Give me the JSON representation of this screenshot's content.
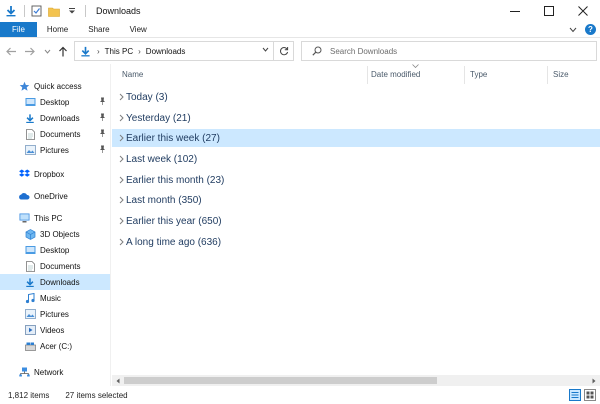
{
  "window": {
    "title": "Downloads",
    "controls": {
      "minimize": "—",
      "maximize": "☐",
      "close": "✕"
    }
  },
  "ribbon": {
    "tabs": [
      "File",
      "Home",
      "Share",
      "View"
    ],
    "help": "?"
  },
  "address": {
    "crumbs": [
      "This PC",
      "Downloads"
    ]
  },
  "search": {
    "placeholder": "Search Downloads"
  },
  "sidebar": {
    "items": [
      {
        "label": "Quick access",
        "icon": "star-icon",
        "pinned": false
      },
      {
        "label": "Desktop",
        "icon": "desktop-folder-icon",
        "pinned": true
      },
      {
        "label": "Downloads",
        "icon": "download-arrow-icon",
        "pinned": true
      },
      {
        "label": "Documents",
        "icon": "documents-icon",
        "pinned": true
      },
      {
        "label": "Pictures",
        "icon": "pictures-icon",
        "pinned": true
      },
      {
        "label": "Dropbox",
        "icon": "dropbox-icon",
        "pinned": false
      },
      {
        "label": "OneDrive",
        "icon": "cloud-icon",
        "pinned": false
      },
      {
        "label": "This PC",
        "icon": "computer-icon",
        "pinned": false
      },
      {
        "label": "3D Objects",
        "icon": "3d-objects-icon",
        "pinned": false
      },
      {
        "label": "Desktop",
        "icon": "desktop-folder-icon",
        "pinned": false
      },
      {
        "label": "Documents",
        "icon": "documents-icon",
        "pinned": false
      },
      {
        "label": "Downloads",
        "icon": "download-arrow-icon",
        "pinned": false,
        "selected": true
      },
      {
        "label": "Music",
        "icon": "music-icon",
        "pinned": false
      },
      {
        "label": "Pictures",
        "icon": "pictures-icon",
        "pinned": false
      },
      {
        "label": "Videos",
        "icon": "videos-icon",
        "pinned": false
      },
      {
        "label": "Acer (C:)",
        "icon": "drive-icon",
        "pinned": false
      },
      {
        "label": "Network",
        "icon": "network-icon",
        "pinned": false
      }
    ]
  },
  "columns": [
    "Name",
    "Date modified",
    "Type",
    "Size"
  ],
  "groups": [
    {
      "label": "Today (3)"
    },
    {
      "label": "Yesterday (21)"
    },
    {
      "label": "Earlier this week (27)",
      "selected": true
    },
    {
      "label": "Last week (102)"
    },
    {
      "label": "Earlier this month (23)"
    },
    {
      "label": "Last month (350)"
    },
    {
      "label": "Earlier this year (650)"
    },
    {
      "label": "A long time ago (636)"
    }
  ],
  "status": {
    "item_count": "1,812 items",
    "selected": "27 items selected"
  },
  "colors": {
    "accent": "#1979ca",
    "selection": "#cce8ff",
    "group_text": "#1e3a5f"
  }
}
